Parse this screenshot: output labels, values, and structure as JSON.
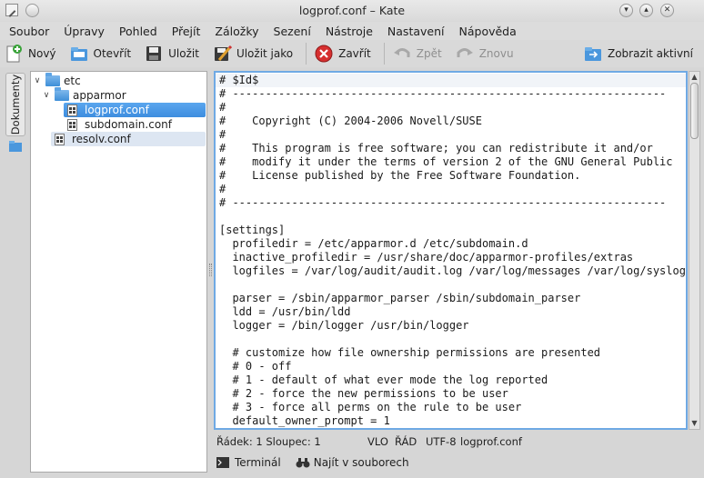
{
  "window": {
    "title": "logprof.conf – Kate"
  },
  "menubar": {
    "items": [
      "Soubor",
      "Úpravy",
      "Pohled",
      "Přejít",
      "Záložky",
      "Sezení",
      "Nástroje",
      "Nastavení",
      "Nápověda"
    ]
  },
  "toolbar": {
    "new_label": "Nový",
    "open_label": "Otevřít",
    "save_label": "Uložit",
    "save_as_label": "Uložit jako",
    "close_label": "Zavřít",
    "undo_label": "Zpět",
    "redo_label": "Znovu",
    "show_active_label": "Zobrazit aktivní"
  },
  "side_tabs": {
    "documents_label": "Dokumenty"
  },
  "tree": {
    "items": [
      {
        "label": "etc",
        "type": "folder",
        "level": 0
      },
      {
        "label": "apparmor",
        "type": "folder",
        "level": 1
      },
      {
        "label": "logprof.conf",
        "type": "file",
        "level": 2,
        "selected": true
      },
      {
        "label": "subdomain.conf",
        "type": "file",
        "level": 2
      },
      {
        "label": "resolv.conf",
        "type": "file",
        "level": 1
      }
    ]
  },
  "editor": {
    "lines": [
      "# $Id$",
      "# ------------------------------------------------------------------",
      "#",
      "#    Copyright (C) 2004-2006 Novell/SUSE",
      "#",
      "#    This program is free software; you can redistribute it and/or",
      "#    modify it under the terms of version 2 of the GNU General Public",
      "#    License published by the Free Software Foundation.",
      "#",
      "# ------------------------------------------------------------------",
      "",
      "[settings]",
      "  profiledir = /etc/apparmor.d /etc/subdomain.d",
      "  inactive_profiledir = /usr/share/doc/apparmor-profiles/extras",
      "  logfiles = /var/log/audit/audit.log /var/log/messages /var/log/syslog",
      "",
      "  parser = /sbin/apparmor_parser /sbin/subdomain_parser",
      "  ldd = /usr/bin/ldd",
      "  logger = /bin/logger /usr/bin/logger",
      "",
      "  # customize how file ownership permissions are presented",
      "  # 0 - off",
      "  # 1 - default of what ever mode the log reported",
      "  # 2 - force the new permissions to be user",
      "  # 3 - force all perms on the rule to be user",
      "  default_owner_prompt = 1"
    ]
  },
  "statusbar": {
    "position": "Řádek: 1 Sloupec: 1",
    "mode": "VLO",
    "insert": "ŘÁD",
    "encoding": "UTF-8",
    "filename": "logprof.conf"
  },
  "bottom_tabs": {
    "terminal_label": "Terminál",
    "find_label": "Najít v souborech"
  },
  "colors": {
    "selection": "#3d8ddf",
    "editor_border": "#6fa9e4",
    "close_icon": "#d62f2f"
  }
}
